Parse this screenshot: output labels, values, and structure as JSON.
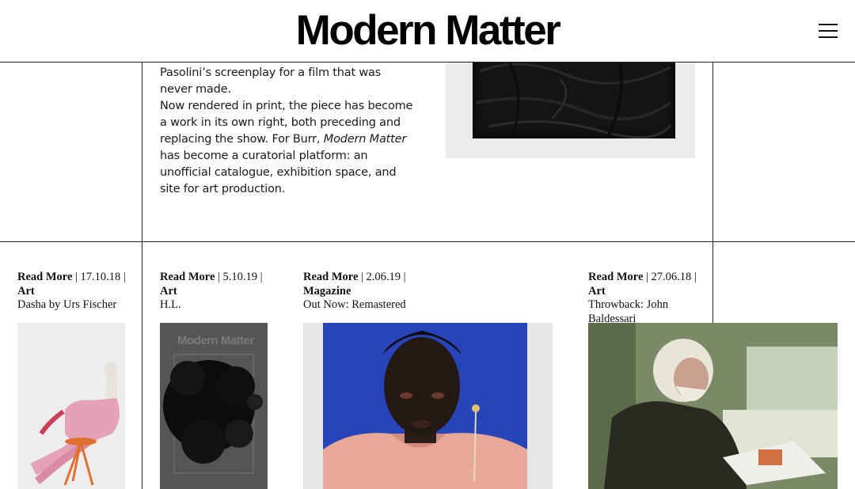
{
  "header": {
    "logo": "Modern Matter",
    "menu_icon": "hamburger-menu-icon"
  },
  "article": {
    "paragraph1": "happened, irrevocably intertwined with Pasolini’s screenplay for a film that was never made.",
    "p2_prefix": "Now rendered in print, the piece has become a work in its own right, both preceding and replacing the show. For Burr,",
    "p2_emph": "Modern Matter",
    "p2_suffix": "has become a curatorial platform: an unofficial catalogue, exhibition space, and site for art production."
  },
  "cards": [
    {
      "read_more": "Read More",
      "date": "| 17.10.18 |",
      "category": "Art",
      "title": "Dasha by Urs Fischer"
    },
    {
      "read_more": "Read More",
      "date": "| 5.10.19 |",
      "category": "Art",
      "title": "H.L."
    },
    {
      "read_more": "Read More",
      "date": "| 2.06.19 |",
      "category": "Magazine",
      "title": "Out Now: Remastered"
    },
    {
      "read_more": "Read More",
      "date": "| 27.06.18 |",
      "category": "Art",
      "title": "Throwback: John Baldessari"
    }
  ],
  "thumbnails": {
    "card2_cover_text": "Modern Matter"
  },
  "colors": {
    "background": "#ffffff",
    "rule": "#222222",
    "text": "#111111",
    "portrait_blue": "#2744b8"
  }
}
